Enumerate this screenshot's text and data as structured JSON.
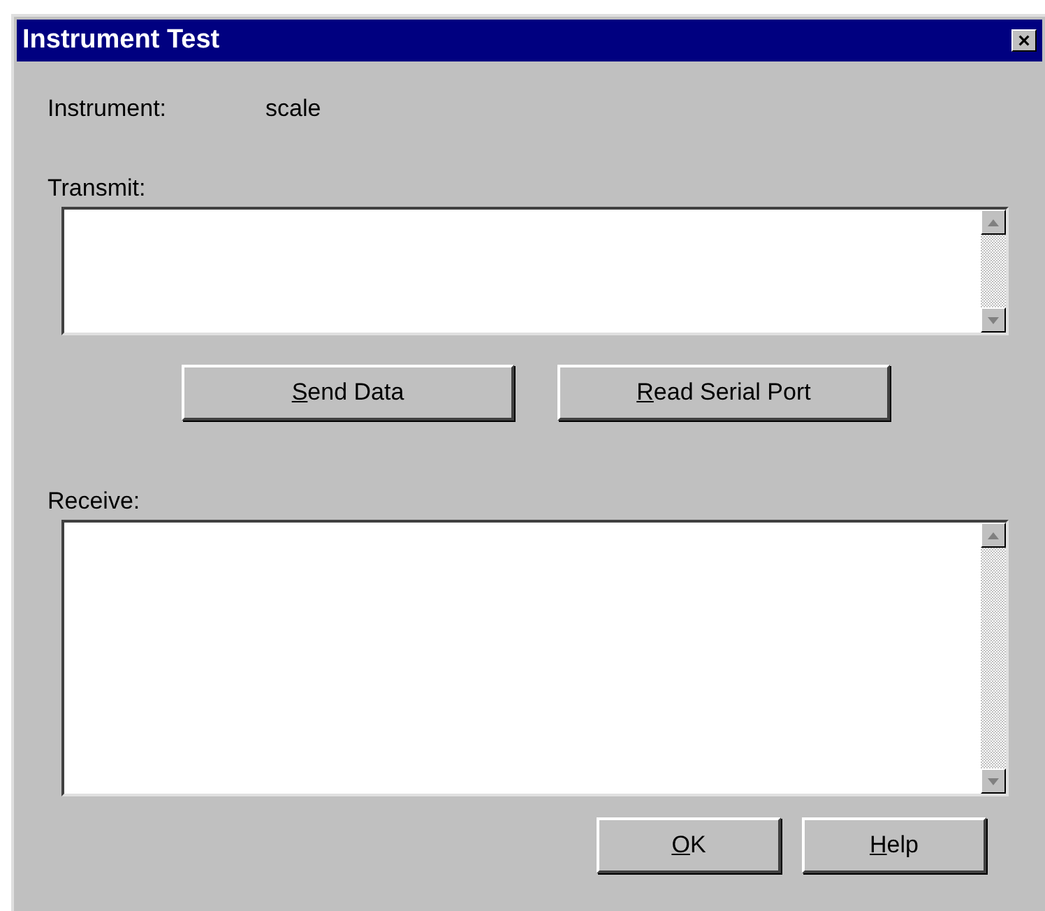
{
  "window": {
    "title": "Instrument Test",
    "close_glyph": "×"
  },
  "instrument": {
    "label": "Instrument:",
    "value": "scale"
  },
  "transmit": {
    "label": "Transmit:"
  },
  "action_buttons": [
    {
      "label": "Send Data",
      "mnemonic_underlined": true
    },
    {
      "label": "Read Serial Port",
      "mnemonic_underlined": true
    }
  ],
  "receive": {
    "label": "Receive:"
  },
  "dialog_buttons": [
    {
      "label": "OK",
      "mnemonic_underlined": true
    },
    {
      "label": "Help",
      "mnemonic_underlined": true
    }
  ]
}
